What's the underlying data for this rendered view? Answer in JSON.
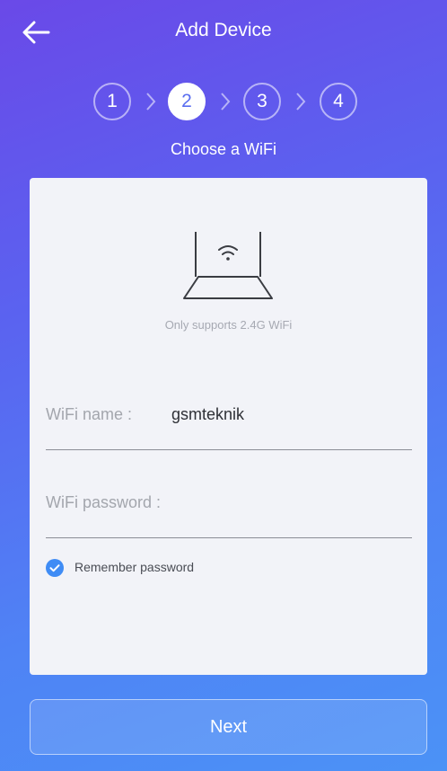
{
  "header": {
    "title": "Add Device",
    "back_icon": "arrow-left-icon"
  },
  "steps": {
    "items": [
      "1",
      "2",
      "3",
      "4"
    ],
    "active_index": 1,
    "subtitle": "Choose a WiFi"
  },
  "card": {
    "router_icon": "router-wifi-icon",
    "support_note": "Only supports 2.4G WiFi",
    "wifi_name": {
      "label": "WiFi name :",
      "value": "gsmteknik"
    },
    "wifi_password": {
      "label": "WiFi password :",
      "value": ""
    },
    "remember": {
      "label": "Remember password",
      "checked": true
    }
  },
  "footer": {
    "next_label": "Next"
  },
  "colors": {
    "accent": "#3f8cf5",
    "card_bg": "#f2f3f8",
    "gradient_start": "#6a49e8",
    "gradient_end": "#4b92f6"
  }
}
